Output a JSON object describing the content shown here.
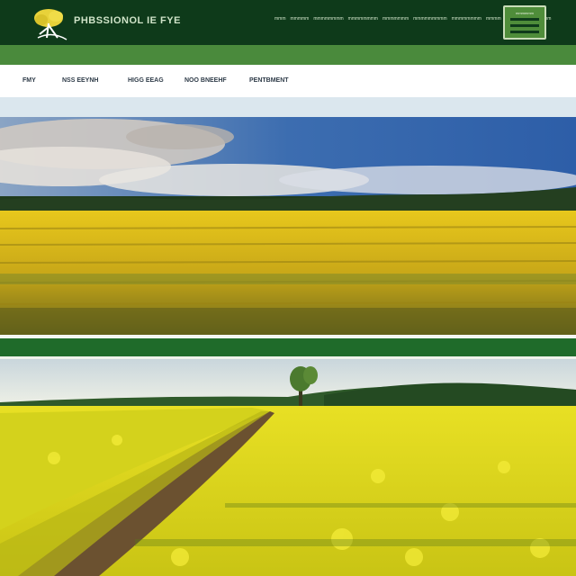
{
  "header": {
    "brand": "PHBSSIONOL IE FYE",
    "top_links": [
      "mmm",
      "mmmmm",
      "mmmmmmmm",
      "mmmmmmmm",
      "mmmmmmm",
      "mmmmmmmmm",
      "mmmmmmmm",
      "mmmm",
      "mmmmmm",
      "mmmmm"
    ],
    "menu_label": "mmmmmm"
  },
  "nav": {
    "items": [
      "FMY",
      "NSS EEYNH",
      "HIGG EEAG",
      "NOO BNEEHF",
      "PENTBMENT"
    ]
  },
  "colors": {
    "header_bg": "#0e3a1a",
    "accent_green": "#4a8a3c",
    "divider_green": "#1f6b2a",
    "pale_band": "#dbe7ee",
    "field_yellow": "#e6c820",
    "rapeseed_yellow": "#f0e020"
  },
  "icons": {
    "logo": "tree-logo-icon",
    "menu": "hamburger-menu-icon"
  }
}
